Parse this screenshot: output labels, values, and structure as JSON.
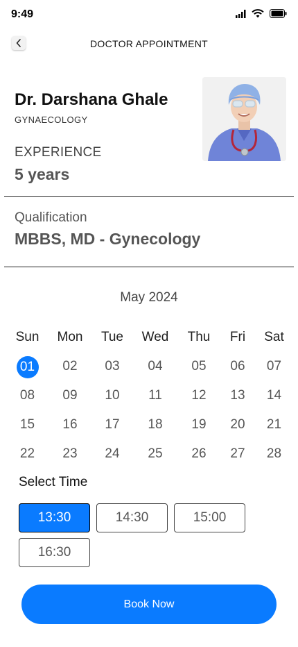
{
  "status_bar": {
    "time": "9:49"
  },
  "header": {
    "title": "DOCTOR APPOINTMENT"
  },
  "doctor": {
    "name": "Dr. Darshana Ghale",
    "specialty": "GYNAECOLOGY",
    "experience_label": "EXPERIENCE",
    "experience_value": "5 years",
    "qualification_label": "Qualification",
    "qualification_value": "MBBS, MD - Gynecology"
  },
  "calendar": {
    "month": "May 2024",
    "weekdays": [
      "Sun",
      "Mon",
      "Tue",
      "Wed",
      "Thu",
      "Fri",
      "Sat"
    ],
    "weeks": [
      [
        "01",
        "02",
        "03",
        "04",
        "05",
        "06",
        "07"
      ],
      [
        "08",
        "09",
        "10",
        "11",
        "12",
        "13",
        "14"
      ],
      [
        "15",
        "16",
        "17",
        "18",
        "19",
        "20",
        "21"
      ],
      [
        "22",
        "23",
        "24",
        "25",
        "26",
        "27",
        "28"
      ]
    ],
    "selected_day": "01"
  },
  "time": {
    "label": "Select Time",
    "slots": [
      "13:30",
      "14:30",
      "15:00",
      "16:30"
    ],
    "selected": "13:30"
  },
  "actions": {
    "book_label": "Book Now"
  },
  "colors": {
    "accent": "#0a7bff"
  }
}
